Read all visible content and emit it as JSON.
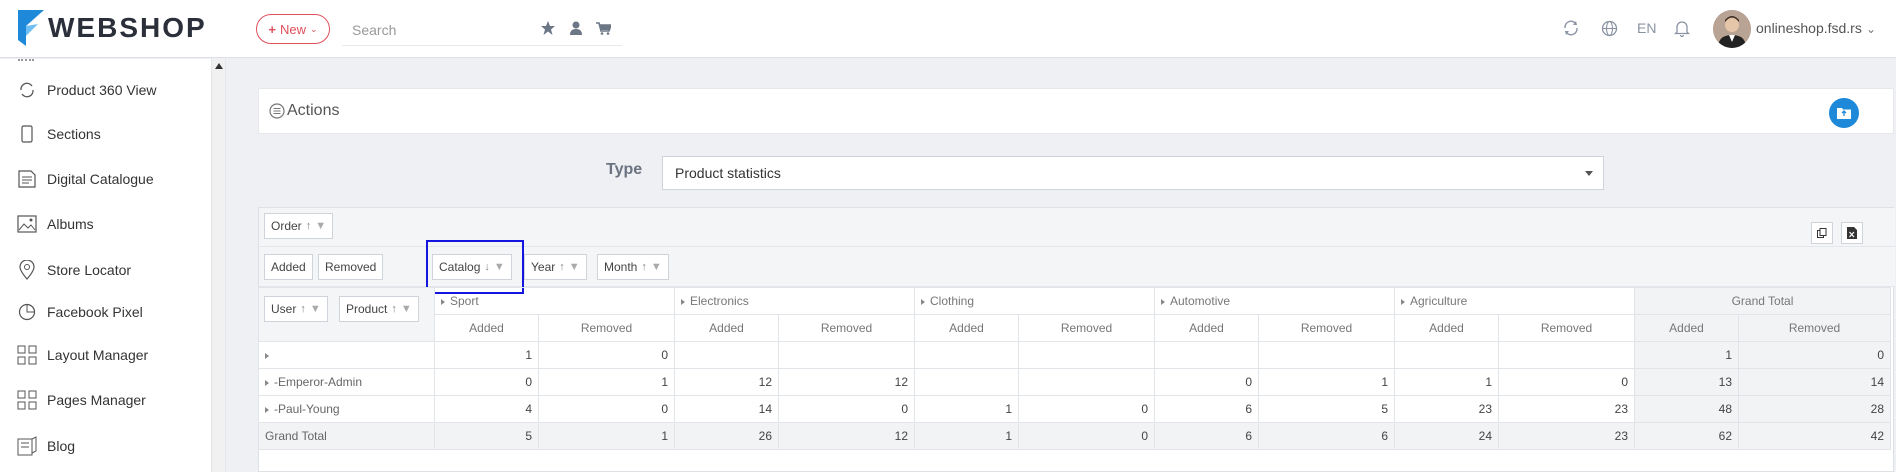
{
  "app": {
    "logo_text": "WEBSHOP",
    "brand_color": "#1e88d9"
  },
  "topbar": {
    "new_label": "New",
    "search_placeholder": "Search",
    "language": "EN",
    "user_name": "onlineshop.fsd.rs",
    "icons": [
      "star-icon",
      "user-icon",
      "cart-icon",
      "sync-icon",
      "globe-icon",
      "bell-icon"
    ]
  },
  "sidebar": {
    "items": [
      {
        "label": "Product 360 View",
        "icon": "rotate-icon"
      },
      {
        "label": "Sections",
        "icon": "tablet-icon"
      },
      {
        "label": "Digital Catalogue",
        "icon": "catalogue-icon"
      },
      {
        "label": "Albums",
        "icon": "image-icon"
      },
      {
        "label": "Store Locator",
        "icon": "store-icon"
      },
      {
        "label": "Facebook Pixel",
        "icon": "pie-icon"
      },
      {
        "label": "Layout Manager",
        "icon": "layout-icon"
      },
      {
        "label": "Pages Manager",
        "icon": "pages-icon"
      },
      {
        "label": "Blog",
        "icon": "blog-icon"
      }
    ]
  },
  "actions": {
    "title": "Actions"
  },
  "type_filter": {
    "label": "Type",
    "value": "Product statistics"
  },
  "pivot": {
    "filter_fields": [
      "Order"
    ],
    "data_fields": [
      "Added",
      "Removed"
    ],
    "column_fields": [
      "Catalog",
      "Year",
      "Month"
    ],
    "row_fields": [
      "User",
      "Product"
    ],
    "categories": [
      "Sport",
      "Electronics",
      "Clothing",
      "Automotive",
      "Agriculture"
    ],
    "grand_total_label": "Grand Total",
    "sub_headers": [
      "Added",
      "Removed"
    ],
    "rows": [
      {
        "label": "",
        "values": [
          "1",
          "0",
          "",
          "",
          "",
          "",
          "",
          "",
          "",
          "",
          "1",
          "0"
        ]
      },
      {
        "label": "-Emperor-Admin",
        "values": [
          "0",
          "1",
          "12",
          "12",
          "",
          "",
          "0",
          "1",
          "1",
          "0",
          "13",
          "14"
        ]
      },
      {
        "label": "-Paul-Young",
        "values": [
          "4",
          "0",
          "14",
          "0",
          "1",
          "0",
          "6",
          "5",
          "23",
          "23",
          "48",
          "28"
        ]
      }
    ],
    "grand_total_row": {
      "label": "Grand Total",
      "values": [
        "5",
        "1",
        "26",
        "12",
        "1",
        "0",
        "6",
        "6",
        "24",
        "23",
        "62",
        "42"
      ]
    }
  }
}
